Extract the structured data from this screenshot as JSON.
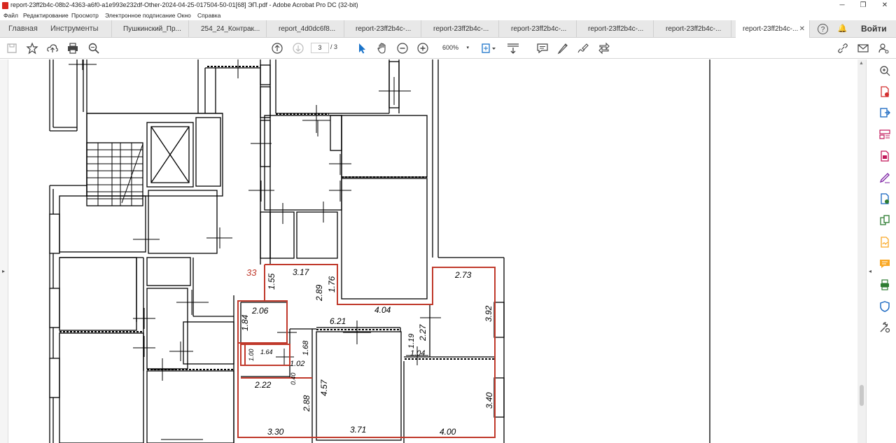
{
  "window": {
    "title": "report-23ff2b4c-08b2-4363-a6f0-a1e993e232df-Other-2024-04-25-017504-50-01[68] ЭП.pdf - Adobe Acrobat Pro DC (32-bit)",
    "minimize": "─",
    "maximize": "❐",
    "close": "✕"
  },
  "menu": [
    "Файл",
    "Редактирование",
    "Просмотр",
    "Электронное подписание",
    "Окно",
    "Справка"
  ],
  "tabs": {
    "home": "Главная",
    "tools": "Инструменты",
    "documents": [
      "Пушкинский_Пр...",
      "254_24_Контрак...",
      "report_4d0dc6f8...",
      "report-23ff2b4c-...",
      "report-23ff2b4c-...",
      "report-23ff2b4c-...",
      "report-23ff2b4c-...",
      "report-23ff2b4c-...",
      "report-23ff2b4c-..."
    ],
    "close_glyph": "✕",
    "help_glyph": "?",
    "bell_glyph": "🔔",
    "signin": "Войти"
  },
  "toolbar": {
    "current_page": "3",
    "page_separator": "/",
    "total_pages": "3",
    "zoom": "600%",
    "zoom_caret": "▾"
  },
  "plan": {
    "unit_number": "33",
    "dimensions": [
      "3.17",
      "1.55",
      "2.89",
      "1.76",
      "2.73",
      "4.04",
      "2.06",
      "1.84",
      "6.21",
      "2.27",
      "3.92",
      "1.19",
      "1.04",
      "1.64",
      "1.00",
      "1.02",
      "1.68",
      "0.40",
      "2.22",
      "4.57",
      "2.88",
      "3.40",
      "3.30",
      "3.71",
      "4.00"
    ]
  },
  "colors": {
    "accent_red": "#c0392b",
    "line": "#000000"
  }
}
